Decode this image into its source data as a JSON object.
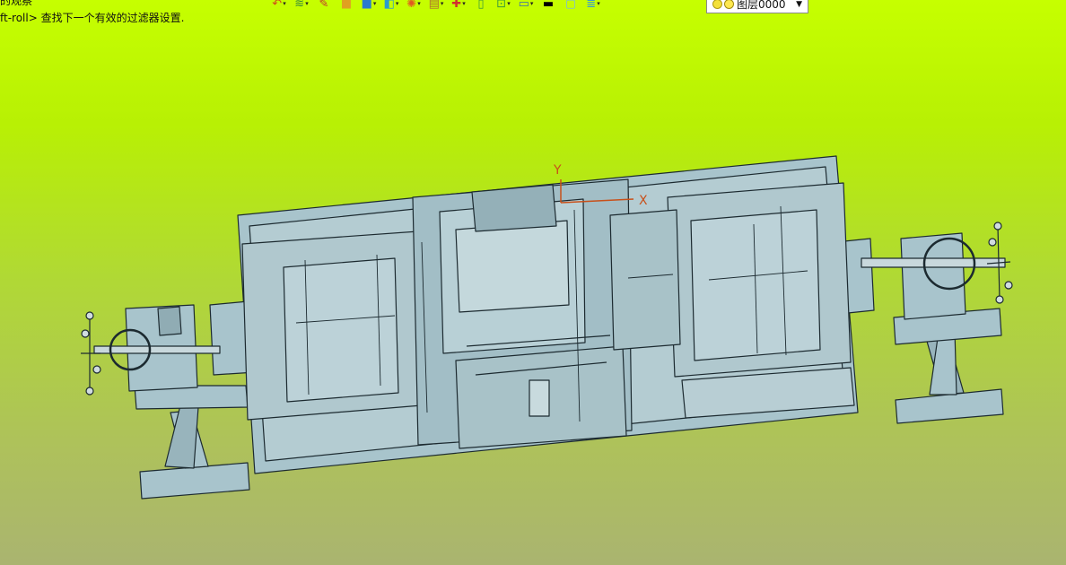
{
  "status": {
    "top_hint": "的观察",
    "hint_line": "ft-roll> 查找下一个有效的过滤器设置."
  },
  "toolbar": {
    "icons": [
      "undo-icon",
      "layers-icon",
      "pencil-icon",
      "cube-icon",
      "cube-blue-icon",
      "cube-view-icon",
      "render-icon",
      "sketch-icon",
      "snap-icon",
      "rect-icon",
      "frame-icon",
      "monitor-icon",
      "color-black-icon",
      "color-swatch-icon",
      "stack-icon"
    ],
    "layer_value": "图层0000"
  },
  "axes": {
    "y_label": "Y",
    "x_label": "X"
  },
  "colors": {
    "background_top": "#c6ff00",
    "background_bottom": "#aab470",
    "model_fill": "#a8c4cc",
    "model_edge": "#1c2a30",
    "axis_color": "#c8501a"
  }
}
